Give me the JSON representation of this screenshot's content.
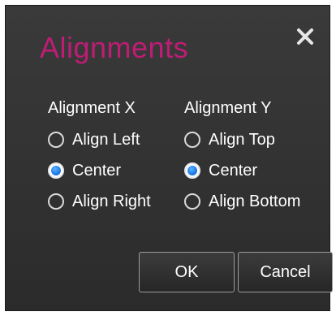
{
  "dialog": {
    "title": "Alignments",
    "close_icon": "close-icon",
    "accent_color": "#c01c75",
    "radio_color": "#1f7fe6"
  },
  "alignment_x": {
    "header": "Alignment X",
    "options": [
      {
        "label": "Align Left",
        "selected": false
      },
      {
        "label": "Center",
        "selected": true
      },
      {
        "label": "Align Right",
        "selected": false
      }
    ]
  },
  "alignment_y": {
    "header": "Alignment Y",
    "options": [
      {
        "label": "Align Top",
        "selected": false
      },
      {
        "label": "Center",
        "selected": true
      },
      {
        "label": "Align Bottom",
        "selected": false
      }
    ]
  },
  "buttons": {
    "ok_label": "OK",
    "cancel_label": "Cancel"
  }
}
